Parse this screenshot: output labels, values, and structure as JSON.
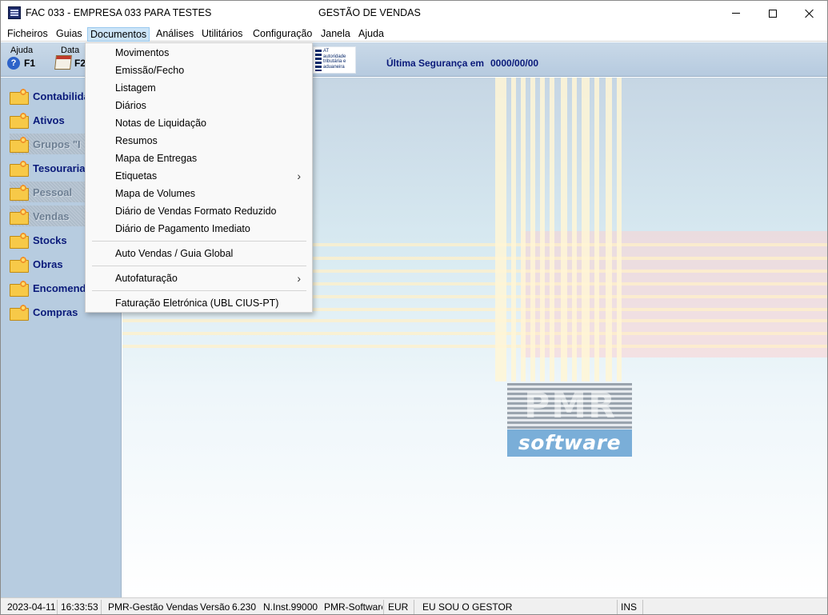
{
  "window": {
    "title": "FAC 033 - EMPRESA 033 PARA TESTES",
    "subtitle": "GESTÃO DE VENDAS"
  },
  "menubar": {
    "items": [
      "Ficheiros",
      "Guias",
      "Documentos",
      "Análises",
      "Utilitários",
      "Configuração",
      "Janela",
      "Ajuda"
    ],
    "active": "Documentos"
  },
  "toolbar": {
    "help_label": "Ajuda",
    "help_key": "F1",
    "date_label": "Data",
    "date_key": "F2",
    "at_logo_text": "AT\nautoridade\ntributária e aduaneira",
    "backup_label": "Última Segurança em",
    "backup_value": "0000/00/00"
  },
  "sidebar": {
    "items": [
      {
        "label": "Contabilidade",
        "enabled": true
      },
      {
        "label": "Ativos",
        "enabled": true
      },
      {
        "label": "Grupos \"I",
        "enabled": false
      },
      {
        "label": "Tesouraria",
        "enabled": true
      },
      {
        "label": "Pessoal",
        "enabled": false
      },
      {
        "label": "Vendas",
        "enabled": false
      },
      {
        "label": "Stocks",
        "enabled": true
      },
      {
        "label": "Obras",
        "enabled": true
      },
      {
        "label": "Encomendas",
        "enabled": true
      },
      {
        "label": "Compras",
        "enabled": true
      }
    ]
  },
  "dropdown": {
    "items": [
      {
        "label": "Movimentos",
        "submenu": false
      },
      {
        "label": "Emissão/Fecho",
        "submenu": false
      },
      {
        "label": "Listagem",
        "submenu": false
      },
      {
        "label": "Diários",
        "submenu": false
      },
      {
        "label": "Notas de Liquidação",
        "submenu": false
      },
      {
        "label": "Resumos",
        "submenu": false
      },
      {
        "label": "Mapa de Entregas",
        "submenu": false
      },
      {
        "label": "Etiquetas",
        "submenu": true
      },
      {
        "label": "Mapa de Volumes",
        "submenu": false
      },
      {
        "label": "Diário de Vendas Formato Reduzido",
        "submenu": false
      },
      {
        "label": "Diário de Pagamento Imediato",
        "submenu": false
      },
      {
        "label": "Auto Vendas / Guia Global",
        "submenu": false
      },
      {
        "label": "Autofaturação",
        "submenu": true
      },
      {
        "label": "Faturação Eletrónica (UBL CIUS-PT)",
        "submenu": false
      }
    ],
    "submenu_arrow": "›"
  },
  "brand": {
    "letters": "PMR",
    "word": "software"
  },
  "statusbar": {
    "date": "2023-04-11",
    "time": "16:33:53",
    "app": "PMR-Gestão Vendas",
    "version_label": "Versão",
    "version": "6.230",
    "install": "N.Inst.99000",
    "vendor": "PMR-Software",
    "currency": "EUR",
    "user": "EU SOU O GESTOR",
    "mode": "INS"
  },
  "colors": {
    "sidebar_bg": "#b7cce0",
    "sidebar_text": "#0a1a7a",
    "menu_active_bg": "#cce4f7",
    "brand_blue": "#7aaed8"
  }
}
